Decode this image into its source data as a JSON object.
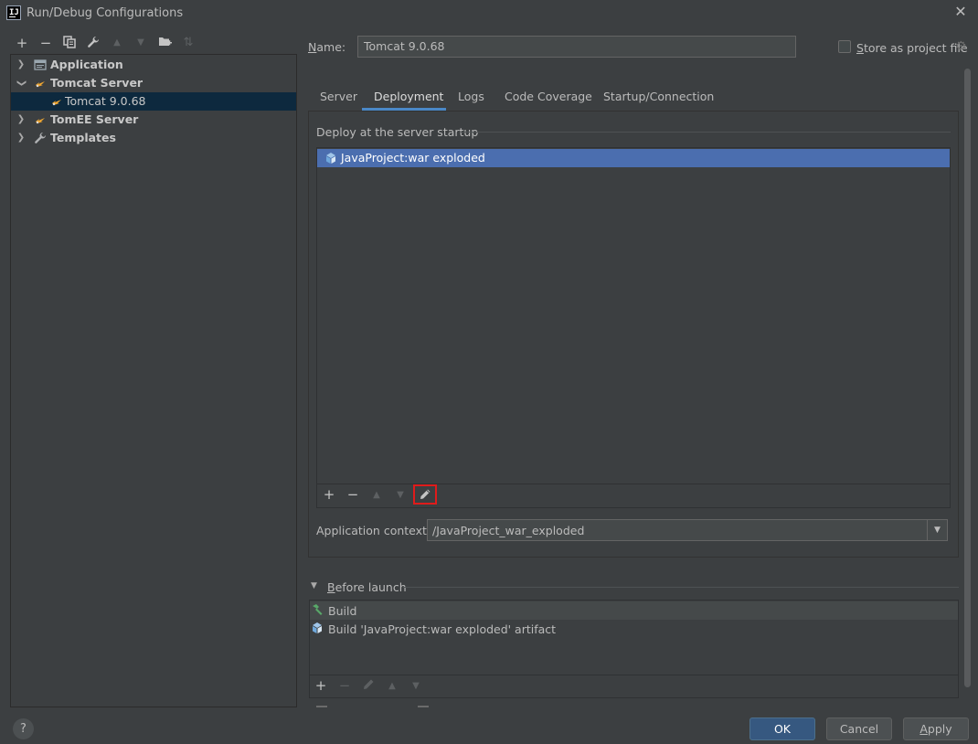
{
  "window": {
    "title": "Run/Debug Configurations",
    "app_icon_text": "IJ"
  },
  "left_toolbar": {
    "add": "+",
    "remove": "−",
    "copy": "⧉",
    "wrench": "🔧",
    "move_up": "▲",
    "move_down": "▼",
    "folder": "📁",
    "sort": "⇅"
  },
  "tree": {
    "items": [
      {
        "label": "Application",
        "expanded": false,
        "bold": true,
        "icon": "application-icon"
      },
      {
        "label": "Tomcat Server",
        "expanded": true,
        "bold": true,
        "icon": "tomcat-icon"
      },
      {
        "label": "Tomcat 9.0.68",
        "selected": true,
        "bold": false,
        "icon": "tomcat-icon"
      },
      {
        "label": "TomEE Server",
        "expanded": false,
        "bold": true,
        "icon": "tomcat-icon"
      },
      {
        "label": "Templates",
        "expanded": false,
        "bold": true,
        "icon": "wrench-icon"
      }
    ]
  },
  "name_field": {
    "label_prefix": "N",
    "label_rest": "ame:",
    "value": "Tomcat 9.0.68"
  },
  "store_as_project": {
    "label_prefix": "S",
    "label_rest": "tore as project file",
    "checked": false
  },
  "tabs": [
    {
      "label": "Server",
      "active": false
    },
    {
      "label": "Deployment",
      "active": true
    },
    {
      "label": "Logs",
      "active": false
    },
    {
      "label": "Code Coverage",
      "active": false
    },
    {
      "label": "Startup/Connection",
      "active": false
    }
  ],
  "deployment": {
    "section_title": "Deploy at the server startup",
    "items": [
      {
        "label": "JavaProject:war exploded",
        "selected": true,
        "icon": "artifact-icon"
      }
    ],
    "toolbar": {
      "add": "+",
      "remove": "−",
      "up": "▲",
      "down": "▼",
      "edit": "✎"
    },
    "context_label": "Application context:",
    "context_value": "/JavaProject_war_exploded"
  },
  "before_launch": {
    "label_prefix": "B",
    "label_rest": "efore launch",
    "items": [
      {
        "label": "Build",
        "icon": "hammer-icon"
      },
      {
        "label": "Build 'JavaProject:war exploded' artifact",
        "icon": "artifact-icon"
      }
    ],
    "toolbar": {
      "add": "+",
      "remove": "−",
      "edit": "✎",
      "up": "▲",
      "down": "▼"
    }
  },
  "buttons": {
    "help": "?",
    "ok": "OK",
    "cancel": "Cancel",
    "apply_prefix": "A",
    "apply_rest": "pply"
  },
  "colors": {
    "accent": "#4a88c7",
    "selection": "#4b6eaf",
    "ok_button": "#365880",
    "highlight_box": "#e01b1b"
  }
}
